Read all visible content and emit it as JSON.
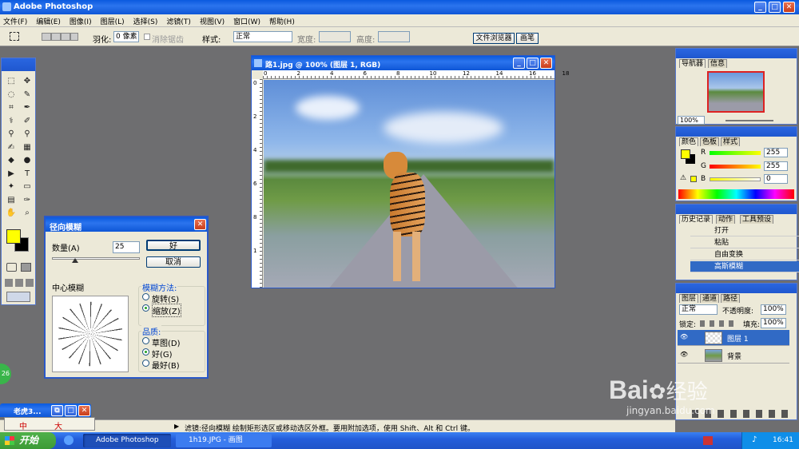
{
  "window": {
    "title": "Adobe Photoshop"
  },
  "menu": [
    "文件(F)",
    "编辑(E)",
    "图像(I)",
    "图层(L)",
    "选择(S)",
    "滤镜(T)",
    "视图(V)",
    "窗口(W)",
    "帮助(H)"
  ],
  "options": {
    "feather_label": "羽化:",
    "feather_value": "0 像素",
    "antialias": "消除锯齿",
    "style_label": "样式:",
    "style_value": "正常",
    "width_label": "宽度:",
    "height_label": "高度:",
    "file_browser": "文件浏览器",
    "brushes": "画笔"
  },
  "document": {
    "title": "路1.jpg @ 100% (图层 1, RGB)",
    "ruler": [
      "0",
      "2",
      "4",
      "6",
      "8",
      "10",
      "12",
      "14",
      "16",
      "18"
    ],
    "vruler": [
      "0",
      "2",
      "4",
      "6",
      "8",
      "1"
    ]
  },
  "dialog": {
    "title": "径向模糊",
    "amount_label": "数量(A)",
    "amount_value": "25",
    "ok": "好",
    "cancel": "取消",
    "center_label": "中心模糊",
    "method_label": "模糊方法:",
    "spin": "旋转(S)",
    "zoom": "缩放(Z)",
    "quality_label": "品质:",
    "draft": "草图(D)",
    "good": "好(G)",
    "best": "最好(B)"
  },
  "navigator": {
    "tabs": [
      "导航器",
      "信息"
    ],
    "zoom": "100%"
  },
  "color": {
    "tabs": [
      "颜色",
      "色板",
      "样式"
    ],
    "r_label": "R",
    "g_label": "G",
    "b_label": "B",
    "r": "255",
    "g": "255",
    "b": "0"
  },
  "history": {
    "tabs": [
      "历史记录",
      "动作",
      "工具预设"
    ],
    "items": [
      "打开",
      "粘贴",
      "自由变换",
      "高斯模糊"
    ]
  },
  "layers": {
    "tabs": [
      "图层",
      "通道",
      "路径"
    ],
    "mode": "正常",
    "opacity_label": "不透明度:",
    "opacity": "100%",
    "lock_label": "锁定:",
    "fill_label": "填充:",
    "fill": "100%",
    "items": [
      "图层 1",
      "背景"
    ]
  },
  "status": {
    "text": "滤镜:径向模糊  绘制矩形选区或移动选区外框。要用附加选项，使用 Shift、Alt 和 Ctrl 键。"
  },
  "mini": {
    "title": "老虎3...",
    "ime": "中",
    "ime_big": "大"
  },
  "badge": {
    "value": "26"
  },
  "taskbar": {
    "start": "开始",
    "items": [
      "Adobe Photoshop",
      "1h19.JPG - 画图"
    ],
    "time": "16:41"
  },
  "watermark": {
    "brand": "Bai",
    "brand2": "经验",
    "url": "jingyan.baidu.com"
  },
  "colors": {
    "fg": "#ffff00",
    "bg": "#000000",
    "titlebar": "#0a5adf",
    "canvas_bg": "#6e6e70"
  }
}
